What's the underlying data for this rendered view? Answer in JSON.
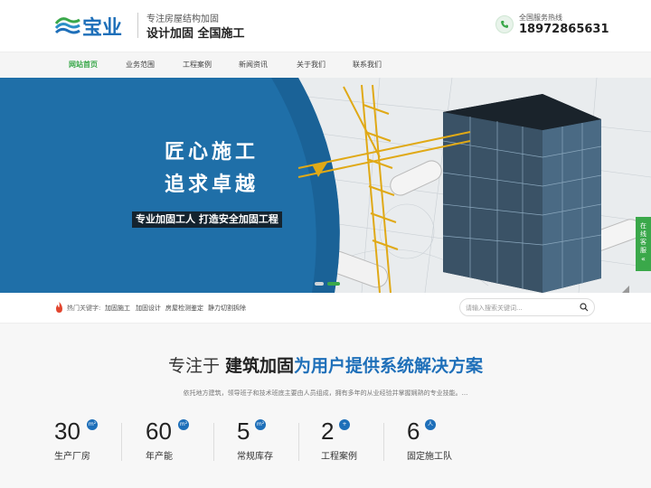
{
  "header": {
    "logo_text": "宝业",
    "slogan_small": "专注房屋结构加固",
    "slogan_big": "设计加固 全国施工",
    "hotline_label": "全国服务热线",
    "hotline_number": "18972865631"
  },
  "nav": {
    "items": [
      "网站首页",
      "业务范围",
      "工程案例",
      "新闻资讯",
      "关于我们",
      "联系我们"
    ],
    "active_index": 0
  },
  "banner": {
    "line1": "匠心施工",
    "line2": "追求卓越",
    "subtitle": "专业加固工人 打造安全加固工程",
    "slide_count": 2,
    "active_slide": 1
  },
  "side_tab": {
    "label": "在线客服"
  },
  "keywords": {
    "label": "热门关键字:",
    "items": [
      "加固施工",
      "加固设计",
      "房屋检测鉴定",
      "静力切割拆除"
    ]
  },
  "search": {
    "placeholder": "请输入搜索关键词..."
  },
  "about": {
    "title_prefix": "专注于",
    "title_bold": "建筑加固",
    "title_accent": "为用户提供系统解决方案",
    "description": "依托地方建筑，领导班子和技术班底主要由人员组成，拥有多年的从业经验并掌握娴熟的专业技能。...",
    "stats": [
      {
        "value": "30",
        "badge": "m²",
        "label": "生产厂房"
      },
      {
        "value": "60",
        "badge": "m²",
        "label": "年产能"
      },
      {
        "value": "5",
        "badge": "m²",
        "label": "常规库存"
      },
      {
        "value": "2",
        "badge": "+",
        "label": "工程案例"
      },
      {
        "value": "6",
        "badge": "人",
        "label": "固定施工队"
      }
    ]
  },
  "colors": {
    "accent_green": "#3aa84a",
    "accent_blue": "#1e6fb9",
    "banner_blue": "#1f6fa8"
  }
}
